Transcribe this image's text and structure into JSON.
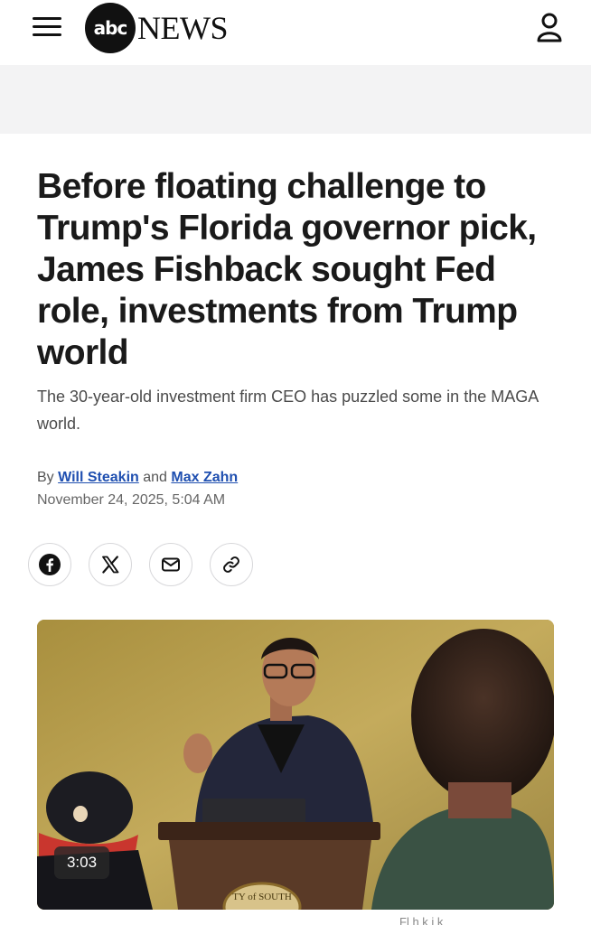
{
  "header": {
    "menu_icon": "hamburger-menu-icon",
    "logo_mark": "abc",
    "logo_word": "NEWS",
    "account_icon": "user-account-icon"
  },
  "article": {
    "headline": "Before floating challenge to Trump's Florida governor pick, James Fishback sought Fed role, investments from Trump world",
    "dek": "The 30-year-old investment firm CEO has puzzled some in the MAGA world.",
    "byline": {
      "prefix": "By",
      "author1": "Will Steakin",
      "joiner": "and",
      "author2": "Max Zahn"
    },
    "date": "November 24, 2025, 5:04 AM"
  },
  "share": {
    "items": [
      "facebook-icon",
      "x-icon",
      "email-icon",
      "link-icon"
    ]
  },
  "media": {
    "duration": "3:03",
    "podium_seal_text": "TY of SOUTH",
    "caption": "Fl      h    k     i    k"
  },
  "colors": {
    "link": "#1f4fb0",
    "ad_band": "#f3f3f4",
    "wall": "#b49a4a"
  }
}
